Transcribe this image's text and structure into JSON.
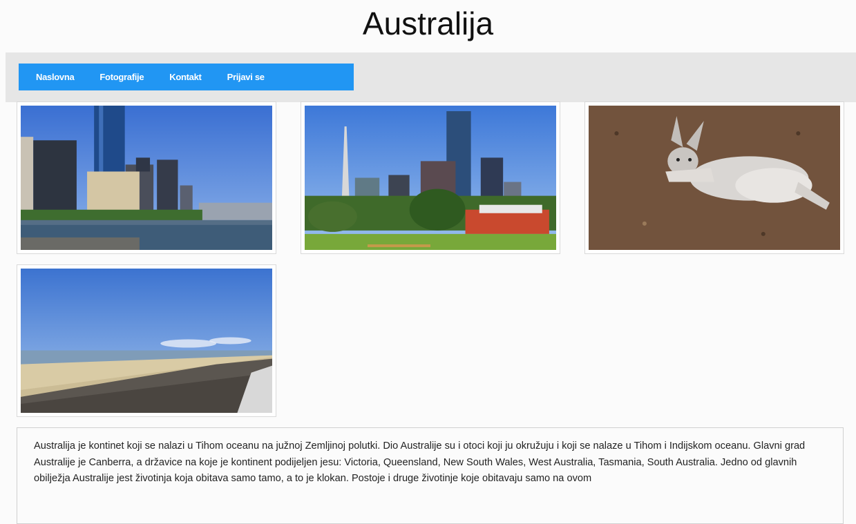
{
  "page": {
    "title": "Australija"
  },
  "nav": {
    "items": [
      "Naslovna",
      "Fotografije",
      "Kontakt",
      "Prijavi se"
    ],
    "bar_color": "#2196f3",
    "background": "#e6e6e6"
  },
  "gallery": {
    "photos": [
      {
        "subject": "melbourne-skyline-river"
      },
      {
        "subject": "melbourne-skyline-park"
      },
      {
        "subject": "kangaroo-resting"
      },
      {
        "subject": "beach-seawall"
      }
    ]
  },
  "article": {
    "text": "Australija je kontinet koji se nalazi u Tihom oceanu na južnoj Zemljinoj polutki. Dio Australije su i otoci koji ju okružuju i koji se nalaze u Tihom i Indijskom oceanu. Glavni grad Australije je Canberra, a državice na koje je kontinent podijeljen jesu: Victoria, Queensland, New South Wales, West Australia, Tasmania, South Australia. Jedno od glavnih obilježja Australije jest životinja koja obitava samo tamo, a to je klokan. Postoje i druge životinje koje obitavaju samo na ovom"
  }
}
